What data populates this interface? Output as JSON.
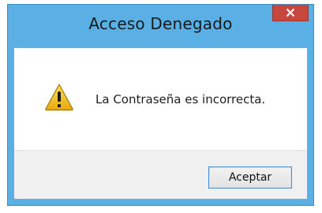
{
  "window": {
    "title": "Acceso Denegado",
    "close_icon": "close-icon"
  },
  "dialog": {
    "icon": "warning-icon",
    "message": "La Contraseña es incorrecta.",
    "ok_label": "Aceptar"
  },
  "colors": {
    "frame": "#5ab0e4",
    "close_button": "#c7473e",
    "footer": "#f0f0f0",
    "button_border": "#3c8fd5",
    "warning_fill": "#f5c518"
  }
}
